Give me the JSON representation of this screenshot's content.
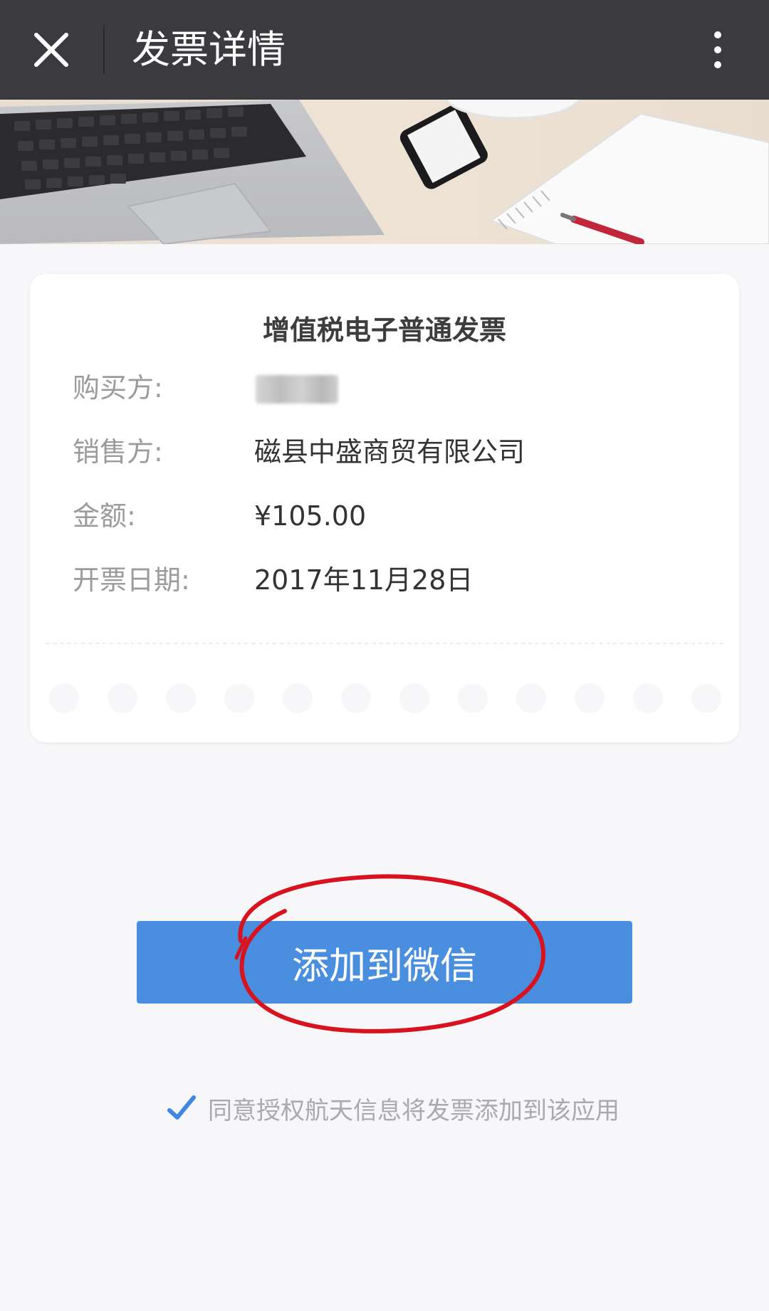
{
  "header": {
    "title": "发票详情",
    "close_icon": "close-icon",
    "more_icon": "more-vertical-icon"
  },
  "card": {
    "title": "增值税电子普通发票",
    "rows": [
      {
        "label": "购买方:",
        "value": ""
      },
      {
        "label": "销售方:",
        "value": "磁县中盛商贸有限公司"
      },
      {
        "label": "金额:",
        "value": "¥105.00"
      },
      {
        "label": "开票日期:",
        "value": "2017年11月28日"
      }
    ]
  },
  "actions": {
    "add_label": "添加到微信"
  },
  "consent": {
    "text": "同意授权航天信息将发票添加到该应用",
    "checked": true,
    "icon": "checkmark-icon"
  },
  "colors": {
    "header_bg": "#3b3a3f",
    "primary_button": "#4a8fdf",
    "annotation_circle": "#d8121f",
    "page_bg": "#f7f7f9"
  }
}
